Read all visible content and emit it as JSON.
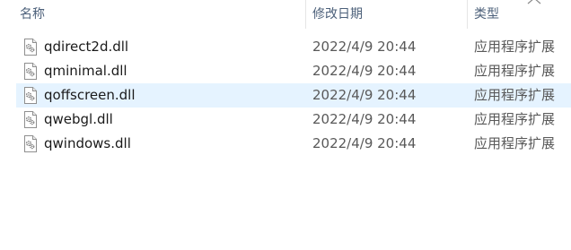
{
  "columns": {
    "name": "名称",
    "date": "修改日期",
    "type": "类型"
  },
  "files": [
    {
      "name": "qdirect2d.dll",
      "date": "2022/4/9 20:44",
      "type": "应用程序扩展",
      "selected": false
    },
    {
      "name": "qminimal.dll",
      "date": "2022/4/9 20:44",
      "type": "应用程序扩展",
      "selected": false
    },
    {
      "name": "qoffscreen.dll",
      "date": "2022/4/9 20:44",
      "type": "应用程序扩展",
      "selected": true
    },
    {
      "name": "qwebgl.dll",
      "date": "2022/4/9 20:44",
      "type": "应用程序扩展",
      "selected": false
    },
    {
      "name": "qwindows.dll",
      "date": "2022/4/9 20:44",
      "type": "应用程序扩展",
      "selected": false
    }
  ],
  "icons": {
    "file": "dll-file-icon",
    "sort": "chevron-up-icon"
  },
  "colors": {
    "selected_row": "#e5f3ff",
    "header_text": "#4c607a"
  }
}
